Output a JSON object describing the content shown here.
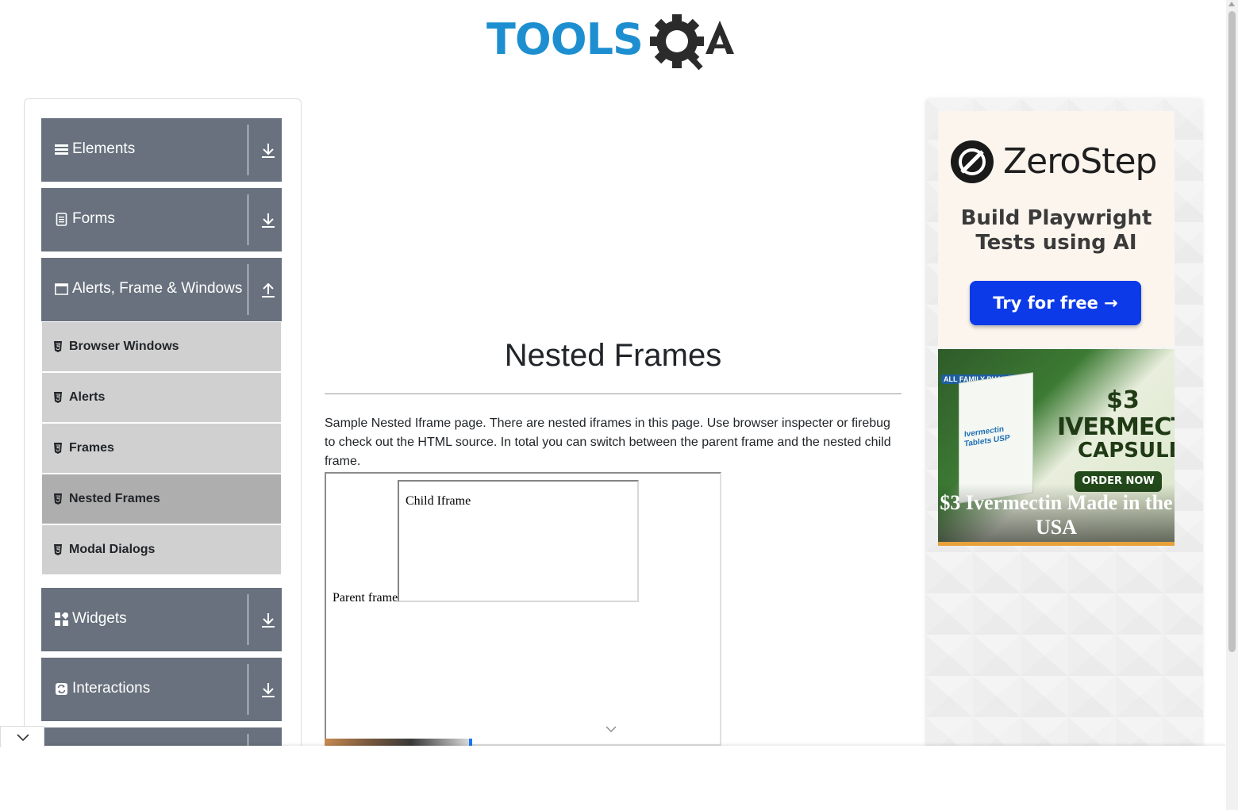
{
  "header": {
    "logo_text_tools": "TOOLS",
    "logo_text_qa": "QA"
  },
  "sidebar": {
    "groups": [
      {
        "label": "Elements",
        "icon": "list-icon",
        "state": "collapsed"
      },
      {
        "label": "Forms",
        "icon": "document-icon",
        "state": "collapsed"
      },
      {
        "label": "Alerts, Frame & Windows",
        "icon": "window-icon",
        "state": "expanded"
      },
      {
        "label": "Widgets",
        "icon": "widgets-icon",
        "state": "collapsed"
      },
      {
        "label": "Interactions",
        "icon": "interactions-icon",
        "state": "collapsed"
      }
    ],
    "subitems": [
      {
        "label": "Browser Windows",
        "active": false
      },
      {
        "label": "Alerts",
        "active": false
      },
      {
        "label": "Frames",
        "active": false
      },
      {
        "label": "Nested Frames",
        "active": true
      },
      {
        "label": "Modal Dialogs",
        "active": false
      }
    ]
  },
  "main": {
    "title": "Nested Frames",
    "description": "Sample Nested Iframe page. There are nested iframes in this page. Use browser inspecter or firebug to check out the HTML source. In total you can switch between the parent frame and the nested child frame.",
    "parent_frame_text": "Parent frame",
    "child_frame_text": "Child Iframe"
  },
  "ads": {
    "zerostep": {
      "brand": "ZeroStep",
      "tagline": "Build Playwright Tests using AI",
      "cta": "Try for free →"
    },
    "ivermectin": {
      "pharma_badge": "ALL FAMILY PHARMA",
      "box_label": "Ivermectin Tablets USP",
      "price": "$3",
      "product_line1": "IVERMECTIN",
      "product_line2": "CAPSULES",
      "order_button": "ORDER NOW",
      "caption": "$3 Ivermectin Made in the USA"
    }
  },
  "colors": {
    "group_bg": "#68717d",
    "sub_bg": "#d0d0d0",
    "sub_active_bg": "#aeaeae",
    "logo_blue": "#1d8fd0",
    "zerostep_cta": "#0c3ae8"
  }
}
